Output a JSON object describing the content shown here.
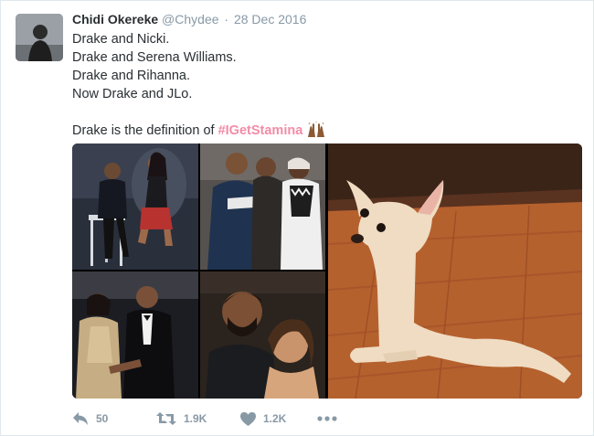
{
  "tweet": {
    "author": {
      "name": "Chidi Okereke",
      "handle": "@Chydee",
      "date": "28 Dec 2016"
    },
    "lines": [
      "Drake and Nicki.",
      "Drake and Serena Williams.",
      "Drake and Rihanna.",
      "Now Drake and JLo."
    ],
    "closing_text": "Drake is the definition of ",
    "hashtag": "#IGetStamina",
    "emoji": "raised-hands-icon",
    "hashtag_color": "#f38ca7",
    "media": {
      "photos": [
        "collage-drake-nicki",
        "collage-drake-serena",
        "collage-drake-rihanna",
        "collage-drake-jlo",
        "stretching-puppy"
      ]
    },
    "stats": {
      "replies": "50",
      "retweets": "1.9K",
      "likes": "1.2K"
    },
    "icons": {
      "reply": "reply-icon",
      "retweet": "retweet-icon",
      "like": "heart-icon",
      "more": "more-dots-icon"
    },
    "colors": {
      "text": "#292f33",
      "meta": "#8899a6",
      "border": "#e1e8ed"
    }
  }
}
